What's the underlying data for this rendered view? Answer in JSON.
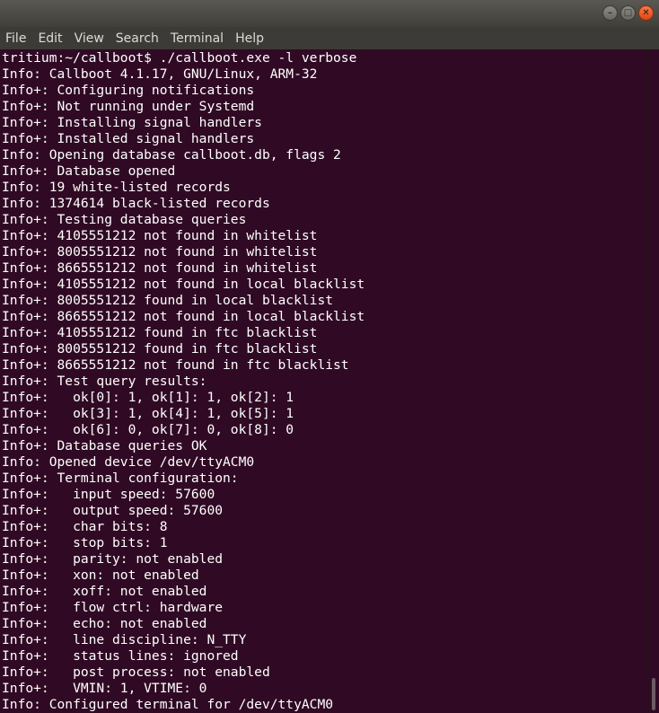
{
  "window": {
    "controls": [
      "minimize-icon",
      "maximize-icon",
      "close-icon"
    ],
    "colors": {
      "terminal_bg": "#300a24",
      "text": "#ffffff",
      "menubar_bg": "#3c3b37",
      "close_accent": "#dd4814"
    }
  },
  "menubar": {
    "items": [
      "File",
      "Edit",
      "View",
      "Search",
      "Terminal",
      "Help"
    ]
  },
  "terminal": {
    "lines": [
      "tritium:~/callboot$ ./callboot.exe -l verbose",
      "Info: Callboot 4.1.17, GNU/Linux, ARM-32",
      "Info+: Configuring notifications",
      "Info+: Not running under Systemd",
      "Info+: Installing signal handlers",
      "Info+: Installed signal handlers",
      "Info: Opening database callboot.db, flags 2",
      "Info+: Database opened",
      "Info: 19 white-listed records",
      "Info: 1374614 black-listed records",
      "Info+: Testing database queries",
      "Info+: 4105551212 not found in whitelist",
      "Info+: 8005551212 not found in whitelist",
      "Info+: 8665551212 not found in whitelist",
      "Info+: 4105551212 not found in local blacklist",
      "Info+: 8005551212 found in local blacklist",
      "Info+: 8665551212 not found in local blacklist",
      "Info+: 4105551212 found in ftc blacklist",
      "Info+: 8005551212 found in ftc blacklist",
      "Info+: 8665551212 not found in ftc blacklist",
      "Info+: Test query results:",
      "Info+:   ok[0]: 1, ok[1]: 1, ok[2]: 1",
      "Info+:   ok[3]: 1, ok[4]: 1, ok[5]: 1",
      "Info+:   ok[6]: 0, ok[7]: 0, ok[8]: 0",
      "Info+: Database queries OK",
      "Info: Opened device /dev/ttyACM0",
      "Info+: Terminal configuration:",
      "Info+:   input speed: 57600",
      "Info+:   output speed: 57600",
      "Info+:   char bits: 8",
      "Info+:   stop bits: 1",
      "Info+:   parity: not enabled",
      "Info+:   xon: not enabled",
      "Info+:   xoff: not enabled",
      "Info+:   flow ctrl: hardware",
      "Info+:   echo: not enabled",
      "Info+:   line discipline: N_TTY",
      "Info+:   status lines: ignored",
      "Info+:   post process: not enabled",
      "Info+:   VMIN: 1, VTIME: 0",
      "Info: Configured terminal for /dev/ttyACM0"
    ]
  }
}
